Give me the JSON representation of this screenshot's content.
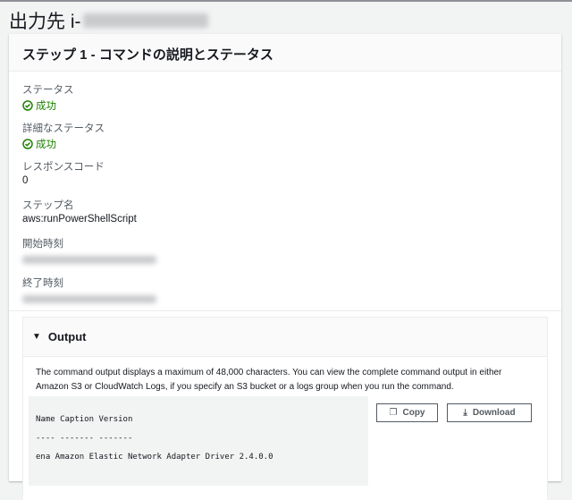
{
  "header": {
    "title_prefix": "出力先 i-"
  },
  "panel": {
    "title": "ステップ 1 - コマンドの説明とステータス"
  },
  "fields": {
    "status_label": "ステータス",
    "status_value": "成功",
    "detail_label": "詳細なステータス",
    "detail_value": "成功",
    "response_label": "レスポンスコード",
    "response_value": "0",
    "step_label": "ステップ名",
    "step_value": "aws:runPowerShellScript",
    "start_label": "開始時刻",
    "end_label": "終了時刻"
  },
  "output": {
    "title": "Output",
    "description": "The command output displays a maximum of 48,000 characters. You can view the complete command output in either Amazon S3 or CloudWatch Logs, if you specify an S3 bucket or a logs group when you run the command.",
    "lines": [
      "Name Caption Version",
      "---- ------- -------",
      "ena Amazon Elastic Network Adapter Driver 2.4.0.0"
    ],
    "copy": "Copy",
    "download": "Download"
  },
  "colors": {
    "success": "#1d8102"
  }
}
